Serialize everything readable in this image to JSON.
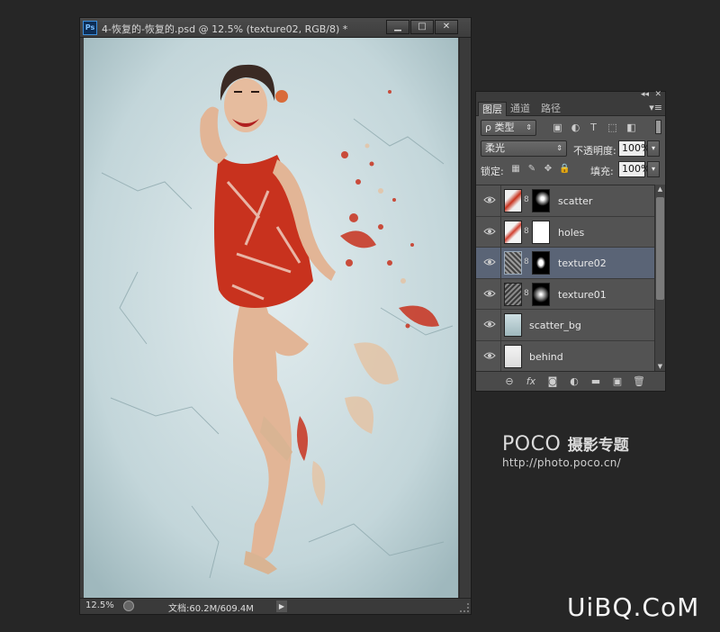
{
  "document": {
    "app_icon_label": "Ps",
    "title": "4-恢复的-恢复的.psd @ 12.5% (texture02, RGB/8) *",
    "window_buttons": {
      "minimize": "▁",
      "maximize": "□",
      "close": "✕"
    },
    "status": {
      "zoom": "12.5%",
      "doc_size": "文档:60.2M/609.4M",
      "arrow": "▶"
    }
  },
  "layers_panel": {
    "tabs": [
      "图层",
      "通道",
      "路径"
    ],
    "active_tab": "图层",
    "filter": {
      "label": "ρ 类型",
      "arrow": "⇕"
    },
    "filter_icons": [
      "image-filter",
      "adjustment-filter",
      "type-filter",
      "shape-filter",
      "smart-object-filter"
    ],
    "blend_mode": "柔光",
    "blend_arrow": "⇕",
    "opacity_label": "不透明度:",
    "opacity_value": "100%",
    "lock_label": "锁定:",
    "fill_label": "填充:",
    "fill_value": "100%",
    "dropdown_arrow": "▾",
    "layers": [
      {
        "name": "scatter",
        "has_mask": true,
        "selected": false,
        "visible": true
      },
      {
        "name": "holes",
        "has_mask": true,
        "selected": false,
        "visible": true
      },
      {
        "name": "texture02",
        "has_mask": true,
        "selected": true,
        "visible": true
      },
      {
        "name": "texture01",
        "has_mask": true,
        "selected": false,
        "visible": true
      },
      {
        "name": "scatter_bg",
        "has_mask": false,
        "selected": false,
        "visible": true
      },
      {
        "name": "behind",
        "has_mask": false,
        "selected": false,
        "visible": true
      }
    ],
    "footer_icons": [
      "link-icon",
      "fx-icon",
      "mask-icon",
      "adjustment-icon",
      "folder-icon",
      "new-layer-icon",
      "trash-icon"
    ],
    "footer_glyphs": [
      "⊖",
      "fx",
      "◙",
      "◐",
      "▬",
      "▣",
      "🗑"
    ]
  },
  "watermarks": {
    "poco_logo": "POCO",
    "poco_subtitle": "摄影专题",
    "poco_url": "http://photo.poco.cn/",
    "uibq": "UiBQ.CoM"
  },
  "colors": {
    "canvas_bg": "#c4d6da",
    "selected_layer": "#5a6476",
    "dress_red": "#c8321e",
    "skin": "#e2b596"
  }
}
